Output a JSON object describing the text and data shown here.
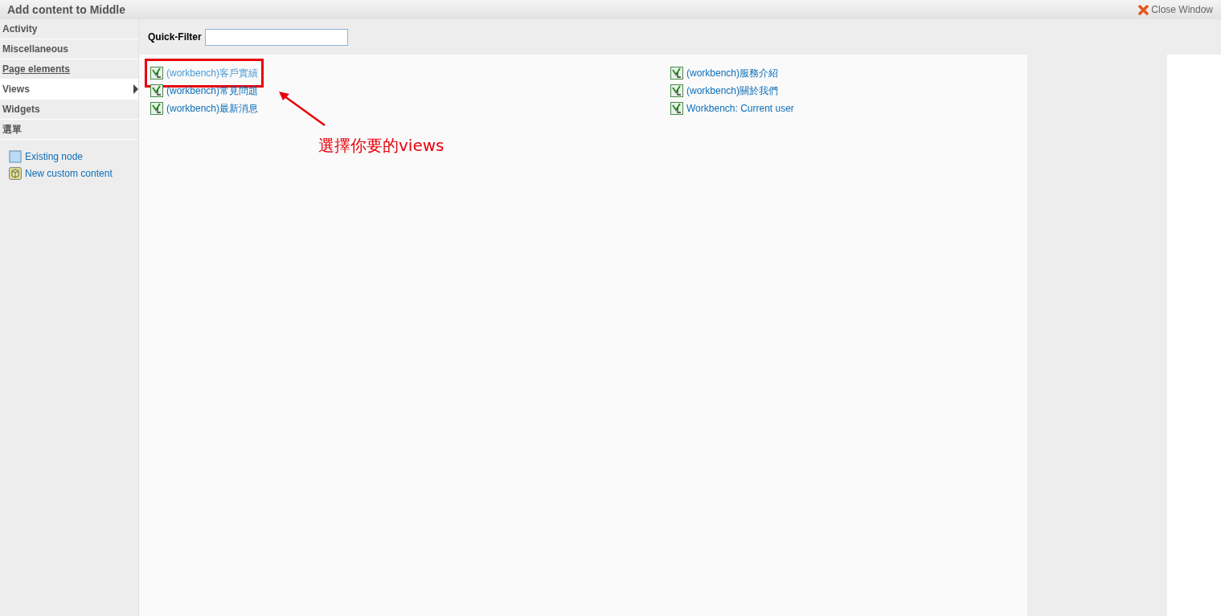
{
  "window": {
    "title": "Add content to Middle",
    "close_label": "Close Window"
  },
  "sidebar": {
    "categories": [
      {
        "label": "Activity",
        "selected": false,
        "underlined": false
      },
      {
        "label": "Miscellaneous",
        "selected": false,
        "underlined": false
      },
      {
        "label": "Page elements",
        "selected": false,
        "underlined": true
      },
      {
        "label": "Views",
        "selected": true,
        "underlined": false
      },
      {
        "label": "Widgets",
        "selected": false,
        "underlined": false
      },
      {
        "label": "選單",
        "selected": false,
        "underlined": false
      }
    ],
    "links": [
      {
        "kind": "node",
        "label": "Existing node"
      },
      {
        "kind": "custom",
        "label": "New custom content"
      }
    ]
  },
  "filter": {
    "label": "Quick-Filter"
  },
  "items": [
    {
      "label": "(workbench)客戶實績",
      "hovered": true,
      "annotated": true
    },
    {
      "label": "(workbench)常見問題",
      "hovered": false,
      "annotated": false
    },
    {
      "label": "(workbench)最新消息",
      "hovered": false,
      "annotated": false
    },
    {
      "label": "(workbench)服務介紹",
      "hovered": false,
      "annotated": false
    },
    {
      "label": "(workbench)關於我們",
      "hovered": false,
      "annotated": false
    },
    {
      "label": "Workbench: Current user",
      "hovered": false,
      "annotated": false
    }
  ],
  "annotation": {
    "text": "選擇你要的views"
  }
}
